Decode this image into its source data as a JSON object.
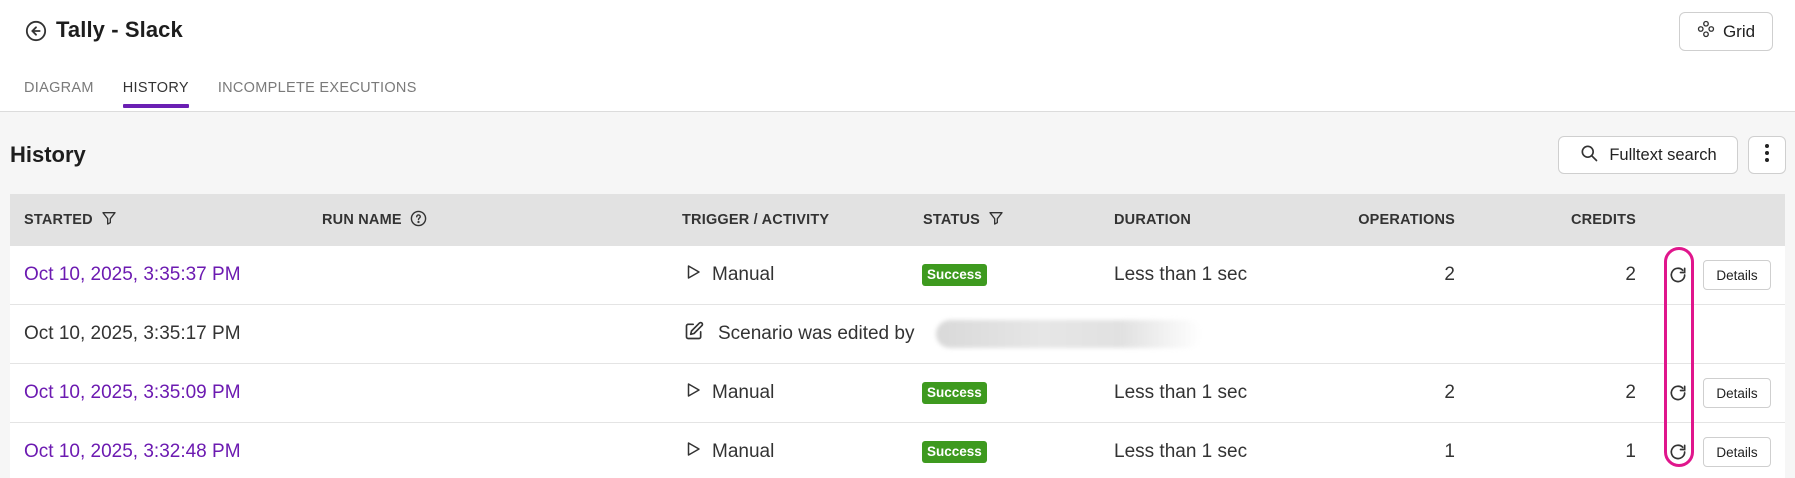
{
  "header": {
    "title": "Tally - Slack",
    "grid_label": "Grid",
    "back_icon": "arrow-left-circle-icon"
  },
  "tabs": [
    {
      "label": "DIAGRAM",
      "active": false
    },
    {
      "label": "HISTORY",
      "active": true
    },
    {
      "label": "INCOMPLETE EXECUTIONS",
      "active": false
    }
  ],
  "history": {
    "title": "History",
    "search_label": "Fulltext search",
    "columns": {
      "started": "STARTED",
      "run_name": "RUN NAME",
      "trigger": "TRIGGER / ACTIVITY",
      "status": "STATUS",
      "duration": "DURATION",
      "operations": "OPERATIONS",
      "credits": "CREDITS"
    },
    "rows": [
      {
        "started": "Oct 10, 2025, 3:35:37 PM",
        "trigger": "Manual",
        "status": "Success",
        "duration": "Less than 1 sec",
        "operations": "2",
        "credits": "2",
        "details": "Details"
      },
      {
        "started": "Oct 10, 2025, 3:35:17 PM",
        "activity": "Scenario was edited by"
      },
      {
        "started": "Oct 10, 2025, 3:35:09 PM",
        "trigger": "Manual",
        "status": "Success",
        "duration": "Less than 1 sec",
        "operations": "2",
        "credits": "2",
        "details": "Details"
      },
      {
        "started": "Oct 10, 2025, 3:32:48 PM",
        "trigger": "Manual",
        "status": "Success",
        "duration": "Less than 1 sec",
        "operations": "1",
        "credits": "1",
        "details": "Details"
      }
    ]
  },
  "colors": {
    "accent": "#6b1fb3",
    "link": "#6c1ab1",
    "success": "#3e9a1f",
    "highlight": "#e0168c"
  }
}
